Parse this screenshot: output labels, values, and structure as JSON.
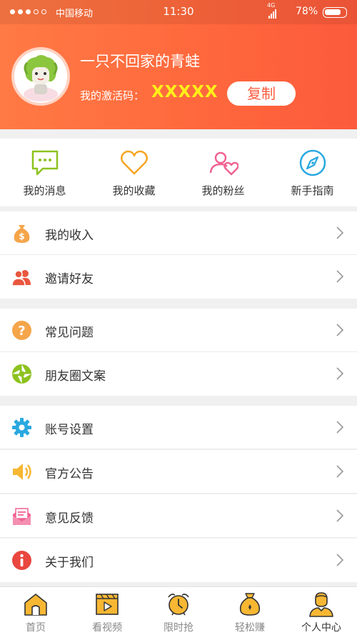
{
  "status_bar": {
    "carrier": "中国移动",
    "time": "11:30",
    "network": "4G",
    "battery": "78%"
  },
  "profile": {
    "username": "一只不回家的青蛙",
    "code_label": "我的激活码：",
    "code_value": "XXXXX",
    "copy_label": "复制"
  },
  "quick_actions": [
    {
      "label": "我的消息",
      "icon": "message-icon",
      "color": "#8dc21f"
    },
    {
      "label": "我的收藏",
      "icon": "heart-icon",
      "color": "#f5a623"
    },
    {
      "label": "我的粉丝",
      "icon": "fans-icon",
      "color": "#f06292"
    },
    {
      "label": "新手指南",
      "icon": "compass-icon",
      "color": "#29a8e0"
    }
  ],
  "menu": [
    {
      "label": "我的收入",
      "icon": "money-bag-icon"
    },
    {
      "label": "邀请好友",
      "icon": "invite-friends-icon"
    },
    {
      "label": "常见问题",
      "icon": "question-icon"
    },
    {
      "label": "朋友圈文案",
      "icon": "moments-icon"
    },
    {
      "label": "账号设置",
      "icon": "gear-icon"
    },
    {
      "label": "官方公告",
      "icon": "speaker-icon"
    },
    {
      "label": "意见反馈",
      "icon": "feedback-icon"
    },
    {
      "label": "关于我们",
      "icon": "info-icon"
    }
  ],
  "tabs": [
    {
      "label": "首页",
      "icon": "home-icon",
      "active": false
    },
    {
      "label": "看视频",
      "icon": "video-icon",
      "active": false
    },
    {
      "label": "限时抢",
      "icon": "alarm-icon",
      "active": false
    },
    {
      "label": "轻松赚",
      "icon": "earn-bag-icon",
      "active": false
    },
    {
      "label": "个人中心",
      "icon": "person-icon",
      "active": true
    }
  ],
  "colors": {
    "header_start": "#ff7a45",
    "header_end": "#fc5a3c",
    "code": "#ffef1a",
    "tab_icon": "#f5a623"
  }
}
